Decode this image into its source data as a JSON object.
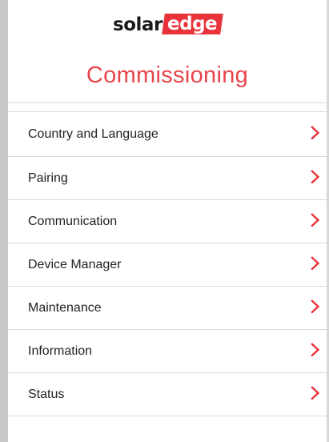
{
  "brand": {
    "logo_part1": "solar",
    "logo_part2": "edge"
  },
  "header": {
    "title": "Commissioning"
  },
  "menu": {
    "items": [
      {
        "label": "Country and Language",
        "icon": "chevron-right-icon"
      },
      {
        "label": "Pairing",
        "icon": "chevron-right-icon"
      },
      {
        "label": "Communication",
        "icon": "chevron-right-icon"
      },
      {
        "label": "Device Manager",
        "icon": "chevron-right-icon"
      },
      {
        "label": "Maintenance",
        "icon": "chevron-right-icon"
      },
      {
        "label": "Information",
        "icon": "chevron-right-icon"
      },
      {
        "label": "Status",
        "icon": "chevron-right-icon"
      }
    ]
  },
  "colors": {
    "accent": "#e8333a",
    "title": "#e8454b",
    "text": "#222222",
    "divider": "#dadada",
    "frame_left": "#c8c8c8"
  }
}
